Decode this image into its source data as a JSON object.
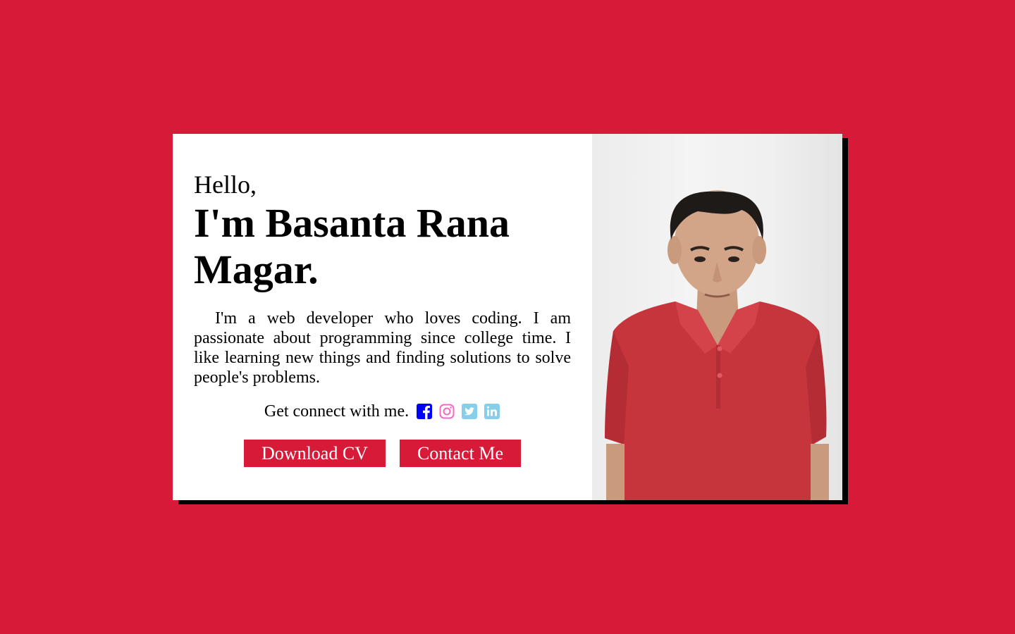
{
  "hero": {
    "greeting": "Hello,",
    "name": "I'm Basanta Rana Magar.",
    "bio": "I'm a web developer who loves coding. I am passionate about programming since college time. I like learning new things and finding solutions to solve people's problems.",
    "connect_text": "Get connect with me.",
    "social": [
      {
        "icon": "facebook-icon",
        "color": "#0000ff"
      },
      {
        "icon": "instagram-icon",
        "color": "#f468c4"
      },
      {
        "icon": "twitter-icon",
        "color": "#87ceeb"
      },
      {
        "icon": "linkedin-icon",
        "color": "#87ceeb"
      }
    ],
    "download_cv_label": "Download CV",
    "contact_me_label": "Contact Me"
  },
  "colors": {
    "page_background": "#d71a37",
    "button_background": "#d71a37",
    "button_text": "#ffffff",
    "card_shadow": "#000000"
  }
}
